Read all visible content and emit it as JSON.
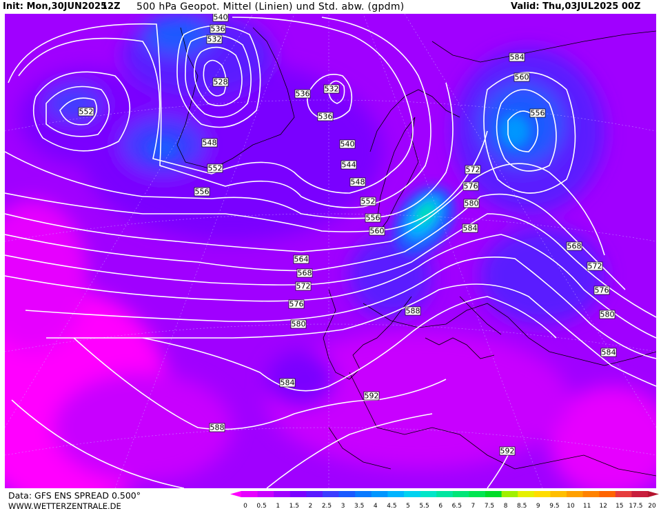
{
  "header": {
    "init": "Init: Mon,30JUN2025",
    "run": "12Z",
    "title": "500 hPa Geopot. Mittel (Linien) und Std. abw. (gpdm)",
    "valid": "Valid: Thu,03JUL2025 00Z"
  },
  "footer": {
    "data_source": "Data: GFS ENS SPREAD 0.500°",
    "website": "WWW.WETTERZENTRALE.DE"
  },
  "legend": {
    "ticks": [
      "0",
      "0.5",
      "1",
      "1.5",
      "2",
      "2.5",
      "3",
      "3.5",
      "4",
      "4.5",
      "5",
      "5.5",
      "6",
      "6.5",
      "7",
      "7.5",
      "8",
      "8.5",
      "9",
      "9.5",
      "10",
      "11",
      "12",
      "15",
      "17.5",
      "20"
    ],
    "colors": [
      "#ff00ff",
      "#e600ff",
      "#c800ff",
      "#a000ff",
      "#7a00ff",
      "#5a1aff",
      "#3c3cff",
      "#1a5aff",
      "#0a7aff",
      "#0096ff",
      "#00b4ff",
      "#00d2f0",
      "#00e6c8",
      "#00e6a0",
      "#00e678",
      "#00e650",
      "#00dc28",
      "#a0f000",
      "#e6f000",
      "#ffdc00",
      "#ffbe00",
      "#ffa000",
      "#ff8200",
      "#ff6400",
      "#e63c3c",
      "#c81e3c",
      "#b4142d"
    ]
  },
  "contour_labels": [
    {
      "v": "540"
    },
    {
      "v": "536"
    },
    {
      "v": "532"
    },
    {
      "v": "528"
    },
    {
      "v": "552"
    },
    {
      "v": "536"
    },
    {
      "v": "532"
    },
    {
      "v": "536"
    },
    {
      "v": "548"
    },
    {
      "v": "540"
    },
    {
      "v": "552"
    },
    {
      "v": "544"
    },
    {
      "v": "556"
    },
    {
      "v": "548"
    },
    {
      "v": "552"
    },
    {
      "v": "556"
    },
    {
      "v": "560"
    },
    {
      "v": "564"
    },
    {
      "v": "568"
    },
    {
      "v": "572"
    },
    {
      "v": "576"
    },
    {
      "v": "580"
    },
    {
      "v": "584"
    },
    {
      "v": "588"
    },
    {
      "v": "592"
    },
    {
      "v": "588"
    },
    {
      "v": "592"
    },
    {
      "v": "584"
    },
    {
      "v": "560"
    },
    {
      "v": "556"
    },
    {
      "v": "572"
    },
    {
      "v": "576"
    },
    {
      "v": "580"
    },
    {
      "v": "584"
    },
    {
      "v": "568"
    },
    {
      "v": "572"
    },
    {
      "v": "576"
    },
    {
      "v": "580"
    },
    {
      "v": "584"
    }
  ]
}
